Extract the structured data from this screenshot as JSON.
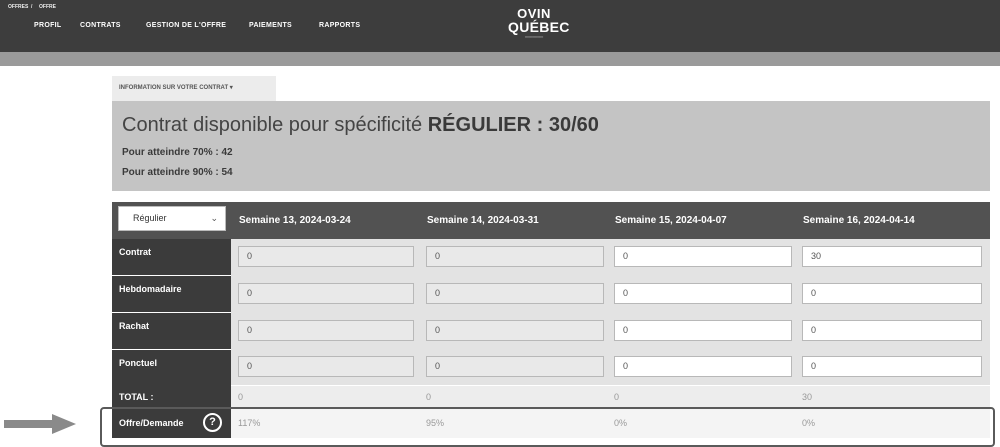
{
  "nav": {
    "items": [
      "PROFIL",
      "CONTRATS",
      "GESTION DE L'OFFRE",
      "PAIEMENTS",
      "RAPPORTS"
    ],
    "logo": {
      "top": "OVIN",
      "main": "QUÉBEC"
    }
  },
  "breadcrumb": [
    "OFFRES",
    "/",
    "OFFRE"
  ],
  "info": {
    "tab_label": "INFORMATION SUR VOTRE CONTRAT ▾",
    "title_prefix": "Contrat disponible pour spécificité",
    "title_strong": "RÉGULIER : 30/60",
    "line1": "Pour atteindre 70% : 42",
    "line2": "Pour atteindre 90% : 54"
  },
  "grid": {
    "select_value": "Régulier",
    "weeks": [
      "Semaine 13, 2024-03-24",
      "Semaine 14, 2024-03-31",
      "Semaine 15, 2024-04-07",
      "Semaine 16, 2024-04-14"
    ],
    "rows": [
      {
        "label": "Contrat",
        "values": [
          "0",
          "0",
          "0",
          "30"
        ]
      },
      {
        "label": "Hebdomadaire",
        "values": [
          "0",
          "0",
          "0",
          "0"
        ]
      },
      {
        "label": "Rachat",
        "values": [
          "0",
          "0",
          "0",
          "0"
        ]
      },
      {
        "label": "Ponctuel",
        "values": [
          "0",
          "0",
          "0",
          "0"
        ]
      }
    ],
    "total": {
      "label": "TOTAL :",
      "values": [
        "0",
        "0",
        "0",
        "30"
      ]
    },
    "offre_demande": {
      "label": "Offre/Demande",
      "help": "?",
      "values": [
        "117%",
        "95%",
        "0%",
        "0%"
      ]
    }
  }
}
